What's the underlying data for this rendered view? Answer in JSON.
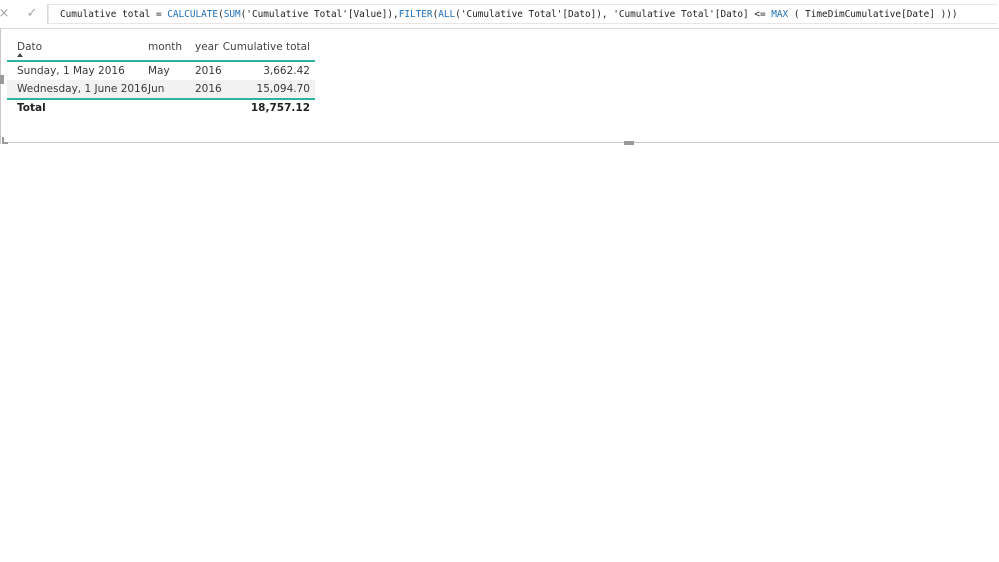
{
  "formula_bar": {
    "cancel_icon": "×",
    "commit_icon": "✓",
    "parts": [
      {
        "text": "Cumulative total = ",
        "kind": "plain"
      },
      {
        "text": "CALCULATE",
        "kind": "fn"
      },
      {
        "text": "(",
        "kind": "plain"
      },
      {
        "text": "SUM",
        "kind": "fn"
      },
      {
        "text": "('Cumulative Total'[Value]),",
        "kind": "plain"
      },
      {
        "text": "FILTER",
        "kind": "fn"
      },
      {
        "text": "(",
        "kind": "plain"
      },
      {
        "text": "ALL",
        "kind": "fn"
      },
      {
        "text": "('Cumulative Total'[Dato]), 'Cumulative Total'[Dato] <= ",
        "kind": "plain"
      },
      {
        "text": "MAX",
        "kind": "fn"
      },
      {
        "text": " ( TimeDimCumulative[Date] )))",
        "kind": "plain"
      }
    ]
  },
  "table": {
    "columns": {
      "dato": "Dato",
      "month": "month",
      "year": "year",
      "cumulative": "Cumulative total"
    },
    "rows": [
      {
        "dato": "Sunday, 1 May 2016",
        "month": "May",
        "year": "2016",
        "cumulative": "3,662.42"
      },
      {
        "dato": "Wednesday, 1 June 2016",
        "month": "Jun",
        "year": "2016",
        "cumulative": "15,094.70"
      }
    ],
    "total": {
      "label": "Total",
      "cumulative": "18,757.12"
    }
  },
  "colors": {
    "accent": "#2bb3a3",
    "function": "#1f6fb6"
  }
}
